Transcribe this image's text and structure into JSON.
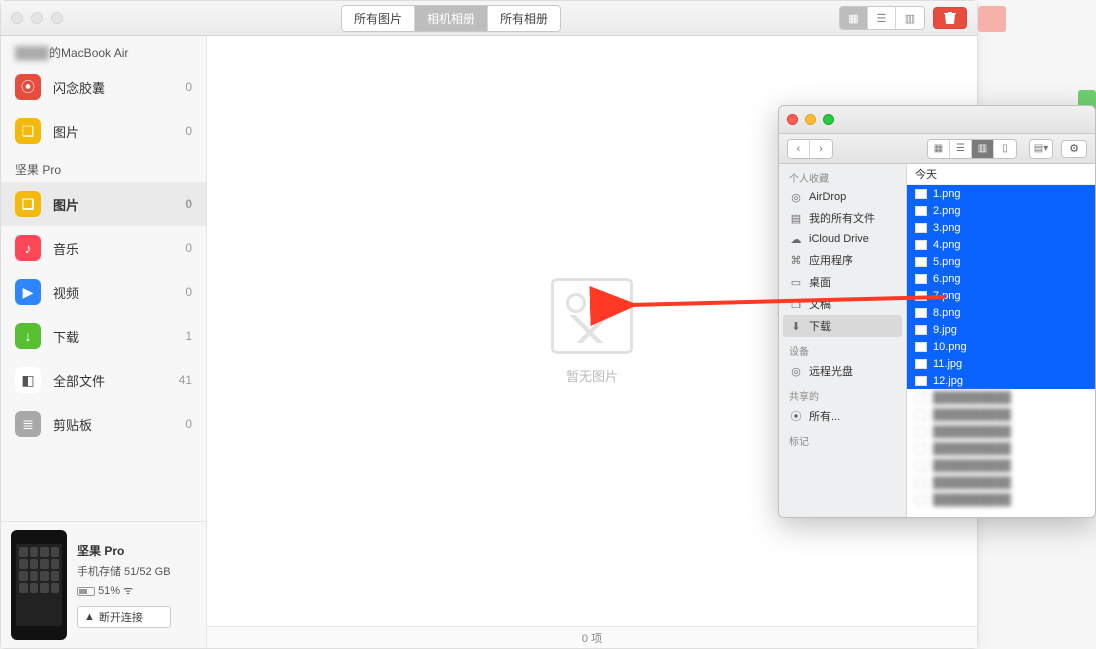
{
  "main": {
    "tabs": [
      {
        "label": "所有图片",
        "active": false
      },
      {
        "label": "相机相册",
        "active": true
      },
      {
        "label": "所有相册",
        "active": false
      }
    ],
    "empty_text": "暂无图片",
    "status": "0 项"
  },
  "sidebar": {
    "section1": "的MacBook Air",
    "items1": [
      {
        "label": "闪念胶囊",
        "count": "0",
        "color": "#e84c3d",
        "icon": "⦿"
      },
      {
        "label": "图片",
        "count": "0",
        "color": "#f3b90d",
        "icon": "❏"
      }
    ],
    "section2": "坚果 Pro",
    "items2": [
      {
        "label": "图片",
        "count": "0",
        "color": "#f3b90d",
        "icon": "❏",
        "selected": true
      },
      {
        "label": "音乐",
        "count": "0",
        "color": "#ff4757",
        "icon": "♪"
      },
      {
        "label": "视频",
        "count": "0",
        "color": "#2e86ff",
        "icon": "▶"
      },
      {
        "label": "下载",
        "count": "1",
        "color": "#57c031",
        "icon": "↓"
      },
      {
        "label": "全部文件",
        "count": "41",
        "color": "#ffffff",
        "icon": "◧",
        "textcolor": "#555"
      },
      {
        "label": "剪贴板",
        "count": "0",
        "color": "#a8a8a8",
        "icon": "≣"
      }
    ],
    "device": {
      "name": "坚果 Pro",
      "storage": "手机存储 51/52 GB",
      "battery": "51%",
      "wifi": "⌇",
      "disconnect": "断开连接",
      "disconnect_icon": "▲"
    }
  },
  "finder": {
    "favorites_head": "个人收藏",
    "favorites": [
      {
        "label": "AirDrop",
        "icon": "◎"
      },
      {
        "label": "我的所有文件",
        "icon": "▤"
      },
      {
        "label": "iCloud Drive",
        "icon": "☁"
      },
      {
        "label": "应用程序",
        "icon": "⌘"
      },
      {
        "label": "桌面",
        "icon": "▭"
      },
      {
        "label": "文稿",
        "icon": "❐"
      },
      {
        "label": "下载",
        "icon": "⬇",
        "selected": true
      }
    ],
    "devices_head": "设备",
    "devices": [
      {
        "label": "远程光盘",
        "icon": "◎"
      }
    ],
    "shared_head": "共享的",
    "shared": [
      {
        "label": "所有...",
        "icon": "⦿"
      }
    ],
    "tags_head": "标记",
    "list_head": "今天",
    "files_selected": [
      "1.png",
      "2.png",
      "3.png",
      "4.png",
      "5.png",
      "6.png",
      "7.png",
      "8.png",
      "9.jpg",
      "10.png",
      "11.jpg",
      "12.jpg"
    ],
    "files_unselected_count": 7
  }
}
